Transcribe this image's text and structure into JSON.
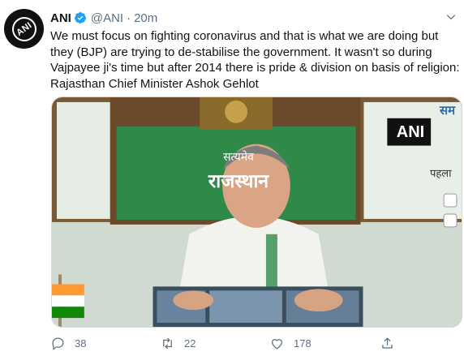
{
  "tweet": {
    "author_name": "ANI",
    "handle": "@ANI",
    "separator": "·",
    "time": "20m",
    "avatar_text": "ANI",
    "text": "We must focus on fighting coronavirus and that is what we are doing but they (BJP) are trying to de-stabilise the government. It wasn't so during Vajpayee ji's time but after 2014 there is pride & division on basis of religion: Rajasthan Chief Minister Ashok Gehlot"
  },
  "media": {
    "watermark": "ANI",
    "banner_line1": "सत्यमेव",
    "banner_line2": "राजस्थान",
    "side_text_top": "सम",
    "side_text_bottom": "पहला"
  },
  "actions": {
    "replies": "38",
    "retweets": "22",
    "likes": "178"
  },
  "icons": {
    "verified": "verified-badge-icon",
    "more": "chevron-down-icon",
    "reply": "reply-icon",
    "retweet": "retweet-icon",
    "like": "heart-icon",
    "share": "share-icon"
  },
  "colors": {
    "verified_blue": "#1da1f2",
    "secondary_text": "#5b7083",
    "banner_green": "#2f8a4a"
  }
}
